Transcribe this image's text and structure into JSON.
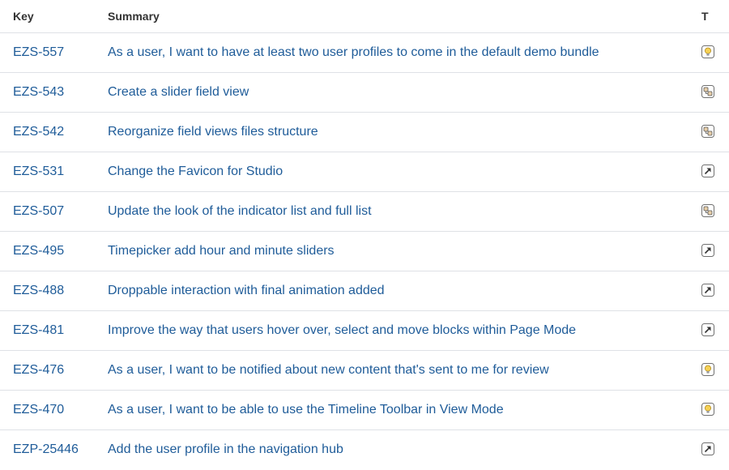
{
  "table": {
    "headers": {
      "key": "Key",
      "summary": "Summary",
      "type": "T"
    },
    "rows": [
      {
        "key": "EZS-557",
        "summary": "As a user, I want to have at least two user profiles to come in the default demo bundle",
        "type_icon": "lightbulb-icon"
      },
      {
        "key": "EZS-543",
        "summary": "Create a slider field view",
        "type_icon": "subtask-icon"
      },
      {
        "key": "EZS-542",
        "summary": "Reorganize field views files structure",
        "type_icon": "subtask-icon"
      },
      {
        "key": "EZS-531",
        "summary": "Change the Favicon for Studio",
        "type_icon": "improvement-arrow-icon"
      },
      {
        "key": "EZS-507",
        "summary": "Update the look of the indicator list and full list",
        "type_icon": "subtask-icon"
      },
      {
        "key": "EZS-495",
        "summary": "Timepicker add hour and minute sliders",
        "type_icon": "improvement-arrow-icon"
      },
      {
        "key": "EZS-488",
        "summary": "Droppable interaction with final animation added",
        "type_icon": "improvement-arrow-icon"
      },
      {
        "key": "EZS-481",
        "summary": "Improve the way that users hover over, select and move blocks within Page Mode",
        "type_icon": "improvement-arrow-icon"
      },
      {
        "key": "EZS-476",
        "summary": "As a user, I want to be notified about new content that's sent to me for review",
        "type_icon": "lightbulb-icon"
      },
      {
        "key": "EZS-470",
        "summary": "As a user, I want to be able to use the Timeline Toolbar in View Mode",
        "type_icon": "lightbulb-icon"
      },
      {
        "key": "EZP-25446",
        "summary": "Add the user profile in the navigation hub",
        "type_icon": "improvement-arrow-icon"
      }
    ]
  },
  "colors": {
    "link": "#1f5c99",
    "header_text": "#333333",
    "row_border": "#dfe1e6",
    "lightbulb_fill": "#f6d155",
    "subtask_fill": "#e8cfa8",
    "icon_border": "#707070"
  }
}
